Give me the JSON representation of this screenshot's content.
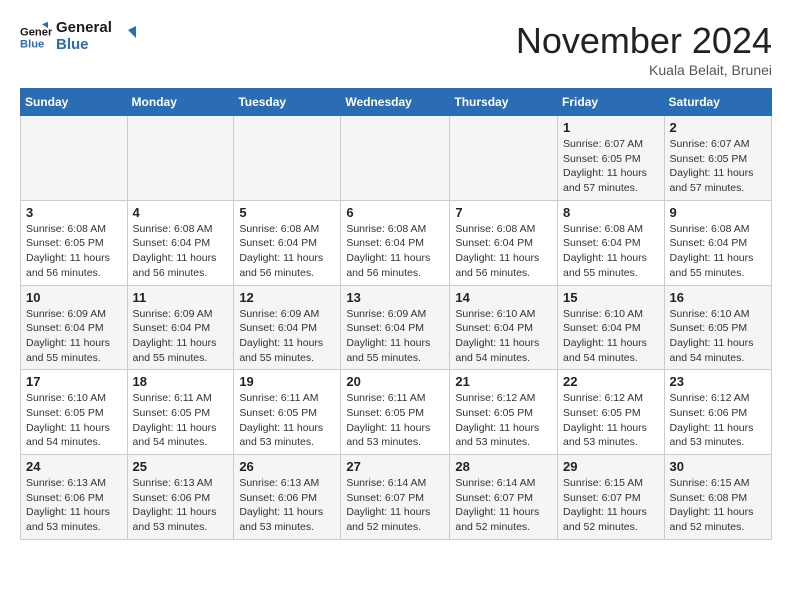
{
  "logo": {
    "line1": "General",
    "line2": "Blue"
  },
  "title": "November 2024",
  "location": "Kuala Belait, Brunei",
  "days_header": [
    "Sunday",
    "Monday",
    "Tuesday",
    "Wednesday",
    "Thursday",
    "Friday",
    "Saturday"
  ],
  "weeks": [
    [
      {
        "num": "",
        "info": ""
      },
      {
        "num": "",
        "info": ""
      },
      {
        "num": "",
        "info": ""
      },
      {
        "num": "",
        "info": ""
      },
      {
        "num": "",
        "info": ""
      },
      {
        "num": "1",
        "info": "Sunrise: 6:07 AM\nSunset: 6:05 PM\nDaylight: 11 hours and 57 minutes."
      },
      {
        "num": "2",
        "info": "Sunrise: 6:07 AM\nSunset: 6:05 PM\nDaylight: 11 hours and 57 minutes."
      }
    ],
    [
      {
        "num": "3",
        "info": "Sunrise: 6:08 AM\nSunset: 6:05 PM\nDaylight: 11 hours and 56 minutes."
      },
      {
        "num": "4",
        "info": "Sunrise: 6:08 AM\nSunset: 6:04 PM\nDaylight: 11 hours and 56 minutes."
      },
      {
        "num": "5",
        "info": "Sunrise: 6:08 AM\nSunset: 6:04 PM\nDaylight: 11 hours and 56 minutes."
      },
      {
        "num": "6",
        "info": "Sunrise: 6:08 AM\nSunset: 6:04 PM\nDaylight: 11 hours and 56 minutes."
      },
      {
        "num": "7",
        "info": "Sunrise: 6:08 AM\nSunset: 6:04 PM\nDaylight: 11 hours and 56 minutes."
      },
      {
        "num": "8",
        "info": "Sunrise: 6:08 AM\nSunset: 6:04 PM\nDaylight: 11 hours and 55 minutes."
      },
      {
        "num": "9",
        "info": "Sunrise: 6:08 AM\nSunset: 6:04 PM\nDaylight: 11 hours and 55 minutes."
      }
    ],
    [
      {
        "num": "10",
        "info": "Sunrise: 6:09 AM\nSunset: 6:04 PM\nDaylight: 11 hours and 55 minutes."
      },
      {
        "num": "11",
        "info": "Sunrise: 6:09 AM\nSunset: 6:04 PM\nDaylight: 11 hours and 55 minutes."
      },
      {
        "num": "12",
        "info": "Sunrise: 6:09 AM\nSunset: 6:04 PM\nDaylight: 11 hours and 55 minutes."
      },
      {
        "num": "13",
        "info": "Sunrise: 6:09 AM\nSunset: 6:04 PM\nDaylight: 11 hours and 55 minutes."
      },
      {
        "num": "14",
        "info": "Sunrise: 6:10 AM\nSunset: 6:04 PM\nDaylight: 11 hours and 54 minutes."
      },
      {
        "num": "15",
        "info": "Sunrise: 6:10 AM\nSunset: 6:04 PM\nDaylight: 11 hours and 54 minutes."
      },
      {
        "num": "16",
        "info": "Sunrise: 6:10 AM\nSunset: 6:05 PM\nDaylight: 11 hours and 54 minutes."
      }
    ],
    [
      {
        "num": "17",
        "info": "Sunrise: 6:10 AM\nSunset: 6:05 PM\nDaylight: 11 hours and 54 minutes."
      },
      {
        "num": "18",
        "info": "Sunrise: 6:11 AM\nSunset: 6:05 PM\nDaylight: 11 hours and 54 minutes."
      },
      {
        "num": "19",
        "info": "Sunrise: 6:11 AM\nSunset: 6:05 PM\nDaylight: 11 hours and 53 minutes."
      },
      {
        "num": "20",
        "info": "Sunrise: 6:11 AM\nSunset: 6:05 PM\nDaylight: 11 hours and 53 minutes."
      },
      {
        "num": "21",
        "info": "Sunrise: 6:12 AM\nSunset: 6:05 PM\nDaylight: 11 hours and 53 minutes."
      },
      {
        "num": "22",
        "info": "Sunrise: 6:12 AM\nSunset: 6:05 PM\nDaylight: 11 hours and 53 minutes."
      },
      {
        "num": "23",
        "info": "Sunrise: 6:12 AM\nSunset: 6:06 PM\nDaylight: 11 hours and 53 minutes."
      }
    ],
    [
      {
        "num": "24",
        "info": "Sunrise: 6:13 AM\nSunset: 6:06 PM\nDaylight: 11 hours and 53 minutes."
      },
      {
        "num": "25",
        "info": "Sunrise: 6:13 AM\nSunset: 6:06 PM\nDaylight: 11 hours and 53 minutes."
      },
      {
        "num": "26",
        "info": "Sunrise: 6:13 AM\nSunset: 6:06 PM\nDaylight: 11 hours and 53 minutes."
      },
      {
        "num": "27",
        "info": "Sunrise: 6:14 AM\nSunset: 6:07 PM\nDaylight: 11 hours and 52 minutes."
      },
      {
        "num": "28",
        "info": "Sunrise: 6:14 AM\nSunset: 6:07 PM\nDaylight: 11 hours and 52 minutes."
      },
      {
        "num": "29",
        "info": "Sunrise: 6:15 AM\nSunset: 6:07 PM\nDaylight: 11 hours and 52 minutes."
      },
      {
        "num": "30",
        "info": "Sunrise: 6:15 AM\nSunset: 6:08 PM\nDaylight: 11 hours and 52 minutes."
      }
    ]
  ]
}
